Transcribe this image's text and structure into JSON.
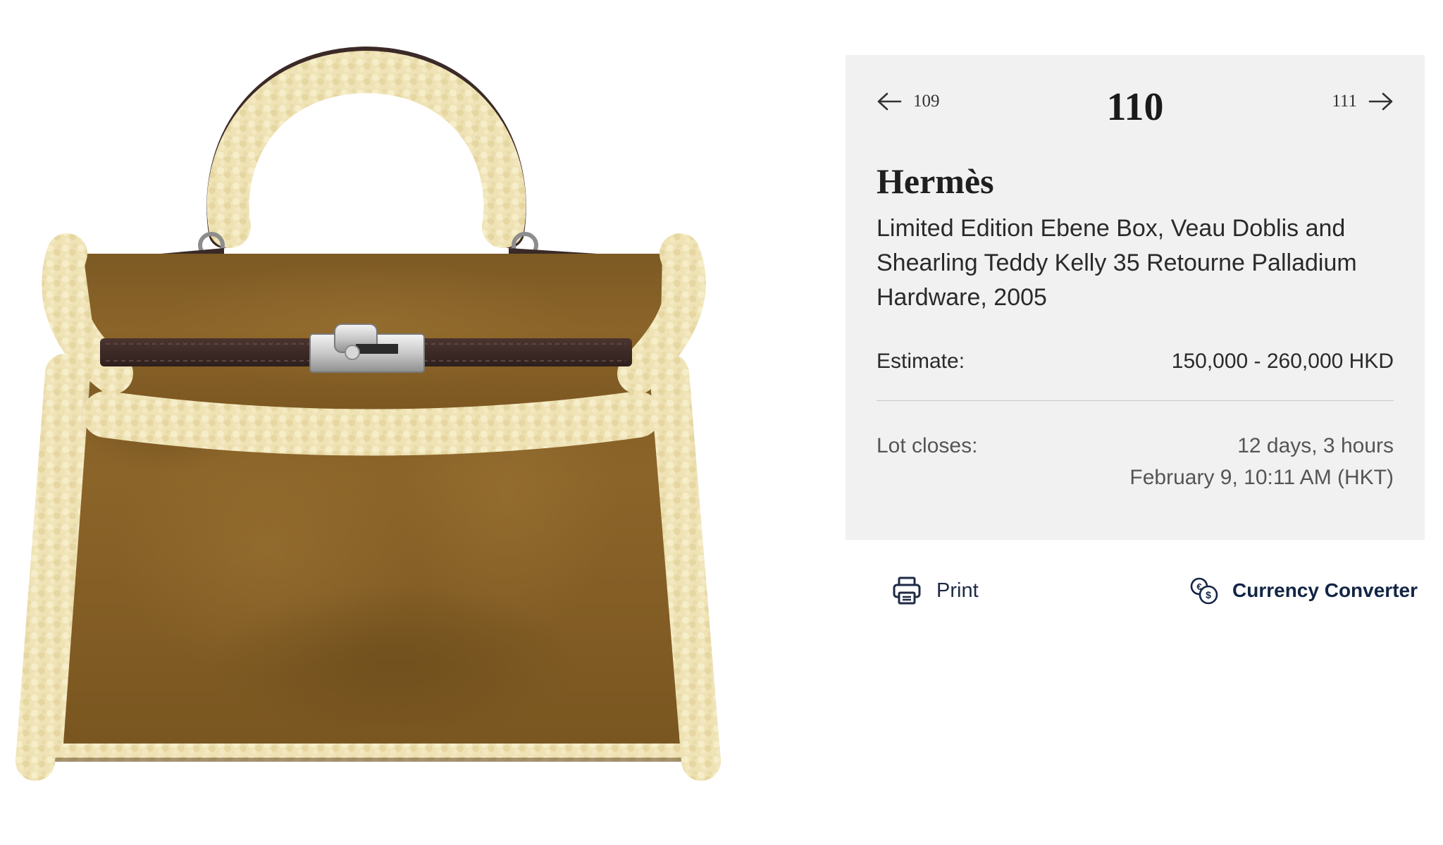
{
  "product": {
    "image_alt": "Hermès Shearling Teddy Kelly 35 bag"
  },
  "lot": {
    "prev_number": "109",
    "current_number": "110",
    "next_number": "111",
    "maker": "Hermès",
    "title": "Limited Edition Ebene Box, Veau Doblis and Shearling Teddy Kelly 35 Retourne Palladium Hardware, 2005",
    "estimate_label": "Estimate:",
    "estimate_value": "150,000 - 260,000 HKD",
    "closes_label": "Lot closes:",
    "closes_countdown": "12 days, 3 hours",
    "closes_datetime": "February 9, 10:11 AM (HKT)"
  },
  "actions": {
    "print_label": "Print",
    "currency_label": "Currency Converter"
  },
  "icons": {
    "prev": "arrow-left-icon",
    "next": "arrow-right-icon",
    "print": "printer-icon",
    "currency": "currency-exchange-icon"
  },
  "colors": {
    "panel_bg": "#f1f1f1",
    "accent_navy": "#132545",
    "suede": "#8a6228",
    "shearling": "#efe3b6",
    "strap": "#3a2824"
  }
}
